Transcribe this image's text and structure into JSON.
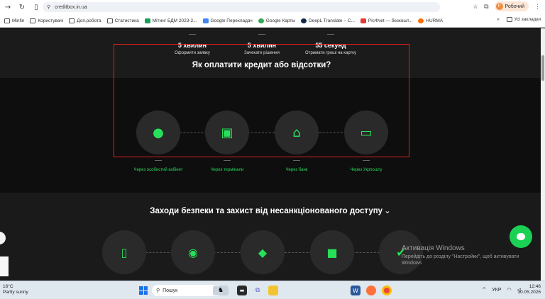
{
  "browser": {
    "url": "creditbox.in.ua",
    "profile_label": "Робочий",
    "profile_initial": "P",
    "bookmarks": [
      {
        "label": "Minfin"
      },
      {
        "label": "Користувачі"
      },
      {
        "label": "Доп.робота"
      },
      {
        "label": "Статистика"
      },
      {
        "label": "Мітинг БДМ 2023-2..."
      },
      {
        "label": "Google Перекладач"
      },
      {
        "label": "Google Карты"
      },
      {
        "label": "DeepL Translate – C..."
      },
      {
        "label": "Pic4Net — безкошт..."
      },
      {
        "label": "HURMA"
      }
    ],
    "bookmarks_overflow": "»",
    "all_bookmarks": "Усі закладки"
  },
  "steps": [
    {
      "big": "5 хвилин",
      "small": "Оформити заявку"
    },
    {
      "big": "5 хвилин",
      "small": "Зачекати рішення"
    },
    {
      "big": "55 секунд",
      "small": "Отримати гроші на картку"
    }
  ],
  "payment": {
    "title": "Як оплатити кредит або відсотки?",
    "methods": [
      {
        "label": "Через особистий кабінет",
        "icon": "user-circle-icon"
      },
      {
        "label": "Через термінали",
        "icon": "terminal-icon"
      },
      {
        "label": "Через банк",
        "icon": "bank-icon"
      },
      {
        "label": "Через Укрпошту",
        "icon": "laptop-icon"
      }
    ]
  },
  "security": {
    "title": "Заходи безпеки та захист від несанкціонованого доступу",
    "chevron": "⌄"
  },
  "activation": {
    "title": "Активація Windows",
    "subtitle_line1": "Перейдіть до розділу \"Настройки\", щоб активувати",
    "subtitle_line2": "Windows"
  },
  "taskbar": {
    "temp": "16°C",
    "weather": "Partly sunny",
    "search_placeholder": "Пошук",
    "lang": "УКР",
    "time": "12:46",
    "date": "30.05.2026"
  },
  "colors": {
    "accent": "#27e05a",
    "highlight_border": "#e02020"
  }
}
